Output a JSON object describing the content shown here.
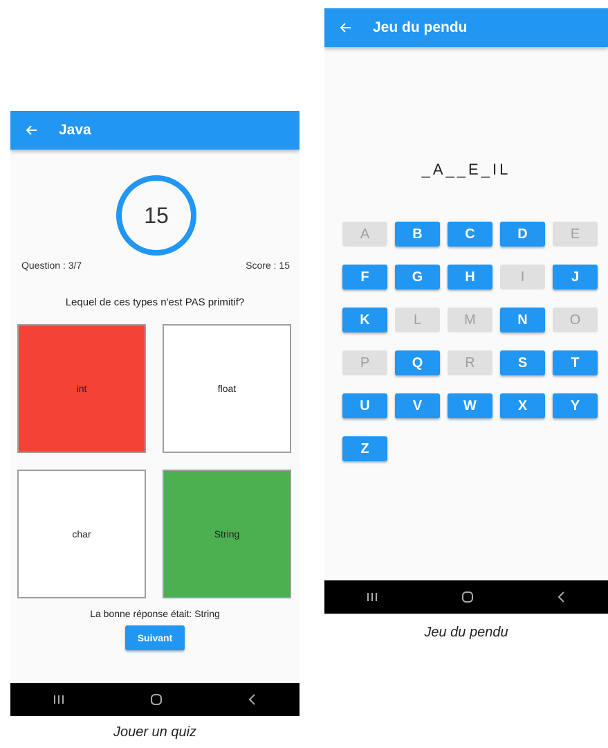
{
  "quiz": {
    "title": "Java",
    "timer": "15",
    "question_counter": "Question : 3/7",
    "score": "Score : 15",
    "question": "Lequel de ces types n'est PAS primitif?",
    "answers": [
      {
        "label": "int",
        "state": "wrong",
        "color": "#f44336"
      },
      {
        "label": "float",
        "state": "neutral",
        "color": "#ffffff"
      },
      {
        "label": "char",
        "state": "neutral",
        "color": "#ffffff"
      },
      {
        "label": "String",
        "state": "right",
        "color": "#4caf50"
      }
    ],
    "feedback": "La bonne réponse était: String",
    "next_label": "Suivant",
    "caption": "Jouer un quiz"
  },
  "hangman": {
    "title": "Jeu du pendu",
    "word": "_A__E_IL",
    "keys": [
      {
        "letter": "A",
        "enabled": false
      },
      {
        "letter": "B",
        "enabled": true
      },
      {
        "letter": "C",
        "enabled": true
      },
      {
        "letter": "D",
        "enabled": true
      },
      {
        "letter": "E",
        "enabled": false
      },
      {
        "letter": "F",
        "enabled": true
      },
      {
        "letter": "G",
        "enabled": true
      },
      {
        "letter": "H",
        "enabled": true
      },
      {
        "letter": "I",
        "enabled": false
      },
      {
        "letter": "J",
        "enabled": true
      },
      {
        "letter": "K",
        "enabled": true
      },
      {
        "letter": "L",
        "enabled": false
      },
      {
        "letter": "M",
        "enabled": false
      },
      {
        "letter": "N",
        "enabled": true
      },
      {
        "letter": "O",
        "enabled": false
      },
      {
        "letter": "P",
        "enabled": false
      },
      {
        "letter": "Q",
        "enabled": true
      },
      {
        "letter": "R",
        "enabled": false
      },
      {
        "letter": "S",
        "enabled": true
      },
      {
        "letter": "T",
        "enabled": true
      },
      {
        "letter": "U",
        "enabled": true
      },
      {
        "letter": "V",
        "enabled": true
      },
      {
        "letter": "W",
        "enabled": true
      },
      {
        "letter": "X",
        "enabled": true
      },
      {
        "letter": "Y",
        "enabled": true
      },
      {
        "letter": "Z",
        "enabled": true
      }
    ],
    "caption": "Jeu du pendu"
  },
  "colors": {
    "primary": "#2196f3",
    "wrong": "#f44336",
    "right": "#4caf50",
    "disabled": "#e0e0e0"
  },
  "icons": {
    "back": "arrow-left-icon",
    "nav": [
      "recent-apps-icon",
      "home-icon",
      "back-chevron-icon"
    ]
  }
}
